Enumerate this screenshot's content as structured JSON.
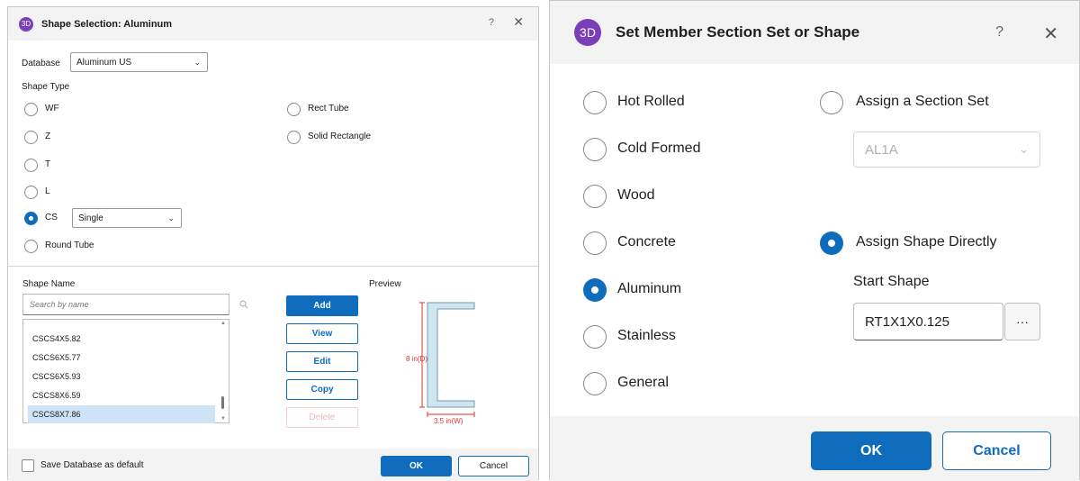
{
  "left_dialog": {
    "badge": "3D",
    "title": "Shape Selection: Aluminum",
    "help": "?",
    "close": "✕",
    "database_label": "Database",
    "database_value": "Aluminum US",
    "shape_type_label": "Shape Type",
    "shape_types": [
      {
        "label": "WF",
        "checked": false
      },
      {
        "label": "Z",
        "checked": false
      },
      {
        "label": "T",
        "checked": false
      },
      {
        "label": "L",
        "checked": false
      },
      {
        "label": "CS",
        "checked": true
      },
      {
        "label": "Round Tube",
        "checked": false
      },
      {
        "label": "Rect Tube",
        "checked": false
      },
      {
        "label": "Solid Rectangle",
        "checked": false
      }
    ],
    "cs_option_value": "Single",
    "shape_name_label": "Shape Name",
    "search_placeholder": "Search by name",
    "shape_list": [
      {
        "name": "CSCS4X5.82",
        "selected": false
      },
      {
        "name": "CSCS6X5.77",
        "selected": false
      },
      {
        "name": "CSCS6X5.93",
        "selected": false
      },
      {
        "name": "CSCS8X6.59",
        "selected": false
      },
      {
        "name": "CSCS8X7.86",
        "selected": true
      }
    ],
    "actions": {
      "add": "Add",
      "view": "View",
      "edit": "Edit",
      "copy": "Copy",
      "delete": "Delete"
    },
    "preview_label": "Preview",
    "preview_depth": "8 in(D)",
    "preview_width": "3.5 in(W)",
    "save_default_label": "Save Database as default",
    "save_default_checked": false,
    "ok": "OK",
    "cancel": "Cancel"
  },
  "right_dialog": {
    "badge": "3D",
    "title": "Set Member Section Set or Shape",
    "help": "?",
    "close": "✕",
    "materials": [
      {
        "label": "Hot Rolled",
        "checked": false
      },
      {
        "label": "Cold Formed",
        "checked": false
      },
      {
        "label": "Wood",
        "checked": false
      },
      {
        "label": "Concrete",
        "checked": false
      },
      {
        "label": "Aluminum",
        "checked": true
      },
      {
        "label": "Stainless",
        "checked": false
      },
      {
        "label": "General",
        "checked": false
      }
    ],
    "assign_section_set_label": "Assign a Section Set",
    "assign_section_set_checked": false,
    "section_set_value": "AL1A",
    "assign_shape_label": "Assign Shape Directly",
    "assign_shape_checked": true,
    "start_shape_label": "Start Shape",
    "start_shape_value": "RT1X1X0.125",
    "browse": "···",
    "ok": "OK",
    "cancel": "Cancel"
  },
  "colors": {
    "accent": "#0f6cbd",
    "badge": "#7a3fb8",
    "titlebar": "#f3f3f3",
    "preview_fill": "#cfe6f2",
    "dimension": "#e03030"
  }
}
